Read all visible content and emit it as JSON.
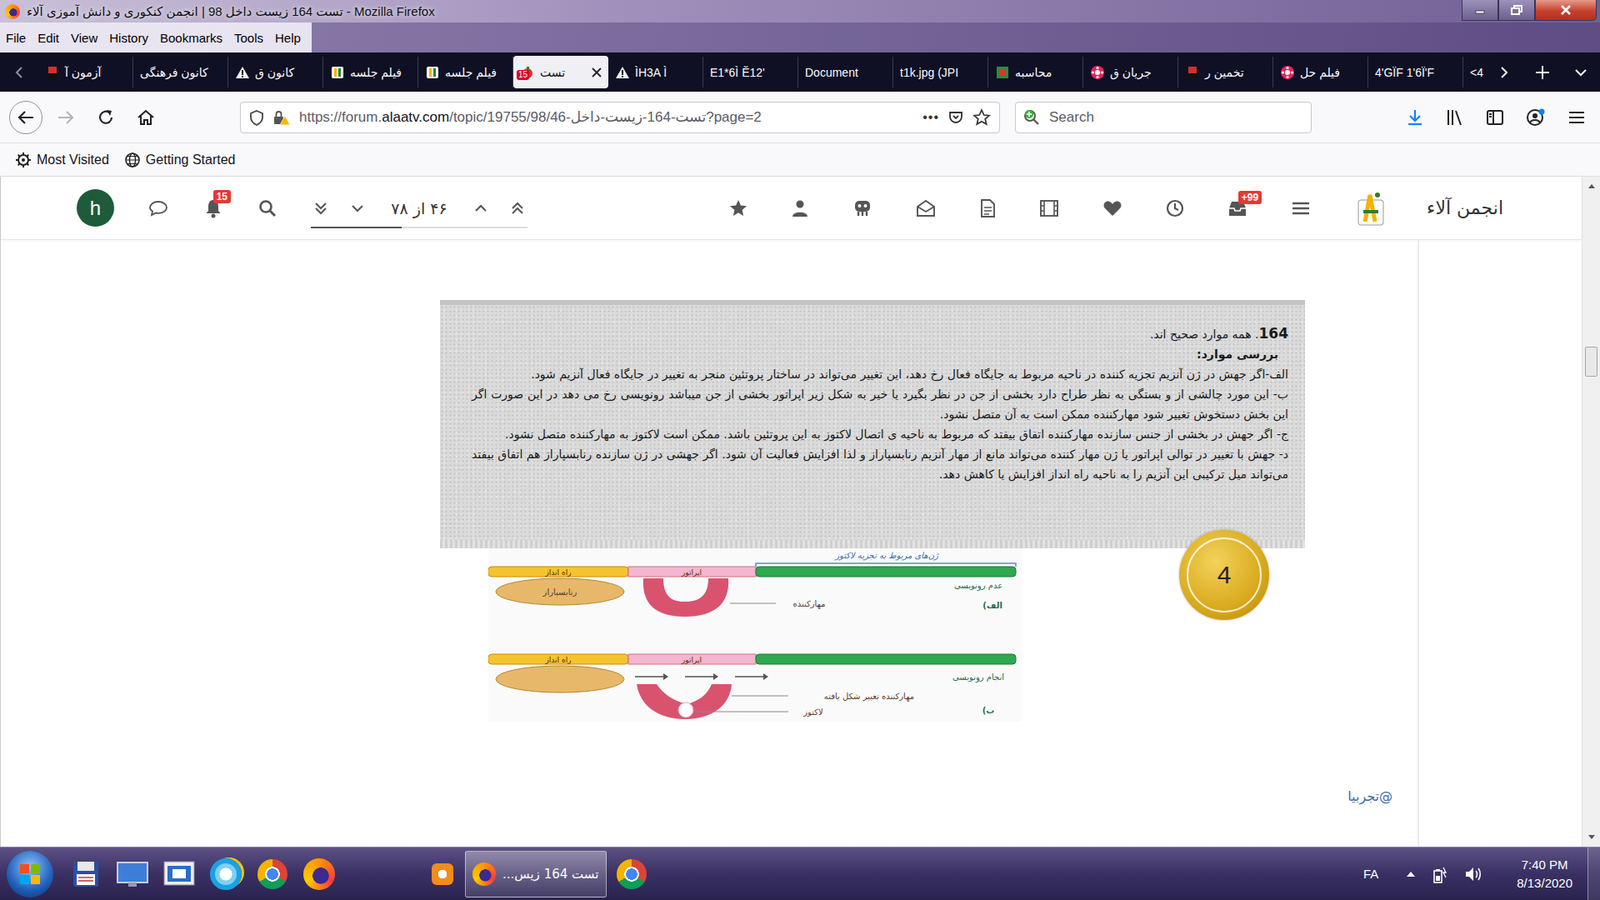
{
  "window": {
    "title": "تست 164 زیست داخل 98 | انجمن کنکوری و دانش آموزی آلاء - Mozilla Firefox"
  },
  "menu": [
    "File",
    "Edit",
    "View",
    "History",
    "Bookmarks",
    "Tools",
    "Help"
  ],
  "tabs": [
    {
      "label": "آزمون آ",
      "kind": "kanoon",
      "selected": false,
      "badge": ""
    },
    {
      "label": "کانون فرهنگی",
      "kind": "none",
      "selected": false,
      "badge": ""
    },
    {
      "label": "کانون ق",
      "kind": "warning",
      "selected": false,
      "badge": ""
    },
    {
      "label": "فیلم جلسه",
      "kind": "alaa",
      "selected": false,
      "badge": ""
    },
    {
      "label": "فیلم جلسه",
      "kind": "alaa",
      "selected": false,
      "badge": ""
    },
    {
      "label": "تست",
      "kind": "apple",
      "selected": true,
      "badge": "15"
    },
    {
      "label": "ÌH3A Ì",
      "kind": "warning",
      "selected": false,
      "badge": ""
    },
    {
      "label": "E1*6Ì Ĕ12'",
      "kind": "none",
      "selected": false,
      "badge": ""
    },
    {
      "label": "Document",
      "kind": "none",
      "selected": false,
      "badge": ""
    },
    {
      "label": "t1k.jpg (JPI",
      "kind": "none",
      "selected": false,
      "badge": ""
    },
    {
      "label": "محاسبه",
      "kind": "green",
      "selected": false,
      "badge": ""
    },
    {
      "label": "جریان ق",
      "kind": "pink",
      "selected": false,
      "badge": ""
    },
    {
      "label": "تخمین ر",
      "kind": "kanoon",
      "selected": false,
      "badge": ""
    },
    {
      "label": "فیلم حل",
      "kind": "pink",
      "selected": false,
      "badge": ""
    },
    {
      "label": "4'GÏF 1'6Ï'F",
      "kind": "none",
      "selected": false,
      "badge": ""
    },
    {
      "label": "<4",
      "kind": "none",
      "selected": false,
      "badge": ""
    }
  ],
  "address_bar": {
    "scheme": "https://forum.",
    "domain": "alaatv.com",
    "path": "/topic/19755/98/46-تست-164-زیست-داخل?page=2",
    "more": "•••"
  },
  "search": {
    "placeholder": "Search"
  },
  "bookmarks": [
    {
      "label": "Most Visited",
      "kind": "gear"
    },
    {
      "label": "Getting Started",
      "kind": "globe"
    }
  ],
  "forum_header": {
    "site_name": "انجمن آلاء",
    "inbox_badge": "+99",
    "notification_badge": "15",
    "avatar": "h",
    "pagination": {
      "text": "۴۶ از ۷۸",
      "level": 0.42
    }
  },
  "post": {
    "number": "164",
    "headline": ". همه موارد صحیح اند.",
    "subheading": "بررسی موارد:",
    "paragraphs": [
      "الف-اگر جهش در ژن آنزیم تجزیه کننده در ناحیه مربوط به جایگاه فعال رخ دهد، این تغییر می‌تواند در ساختار پروتئین منجر به تغییر در جایگاه فعال آنزیم شود.",
      "ب- این مورد چالشی از و بستگی به نظر طراح دارد بخشی از جن در نظر بگیرد یا خیر به شکل زیر اپراتور بخشی از جن میباشد رونویسی رخ می دهد در این صورت اگر این بخش دستخوش تغییر شود مهارکننده ممکن است به آن متصل نشود.",
      "ج- اگر جهش در بخشی از جنس سازنده مهارکننده اتفاق بیفتد که مربوط به ناحیه ی اتصال لاکتوز به این پروتئین باشد. ممکن است لاکتوز به مهارکننده متصل نشود.",
      "د- جهش با تغییر در توالی اپراتور یا ژن مهار کننده می‌تواند مانع از مهار آنزیم رنابسپاراز و لذا افزایش فعالیت آن شود. اگر جهشی در ژن سازنده رنابسپاراز هم اتفاق بیفتد می‌تواند میل ترکیبی این آنزیم را به ناحیه راه انداز افزایش یا کاهش دهد."
    ],
    "figure": {
      "header": "ژن‌های مربوط به تجزیه لاکتوز",
      "panels": [
        {
          "promoter": "راه انداز",
          "operator": "اپراتور",
          "polymerase": "رنابسپاراز",
          "status": "عدم رونویسی",
          "repressor": "مهارکننده",
          "lactose": "",
          "tag": "الف)",
          "transcribing": false
        },
        {
          "promoter": "راه انداز",
          "operator": "اپراتور",
          "polymerase": "",
          "status": "انجام رونویسی",
          "repressor": "مهارکننده تغییر شکل یافته",
          "lactose": "لاکتوز",
          "tag": "ب)",
          "transcribing": true
        }
      ]
    },
    "answer_badge": "4",
    "signature": "@تجربیا"
  },
  "scrollbar": {
    "level": 0.24
  },
  "taskbar": {
    "pinned": [
      {
        "kind": "floppy"
      },
      {
        "kind": "monitor"
      },
      {
        "kind": "remote"
      },
      {
        "kind": "ie"
      },
      {
        "kind": "chrome"
      },
      {
        "kind": "firefox"
      }
    ],
    "windows": [
      {
        "label": "",
        "kind": "orange",
        "selected": false
      },
      {
        "label": "تست 164 زیس...",
        "kind": "firefox",
        "selected": true
      },
      {
        "label": "",
        "kind": "chrome",
        "selected": false
      }
    ],
    "language": "FA",
    "time": "7:40 PM",
    "date": "8/13/2020"
  }
}
